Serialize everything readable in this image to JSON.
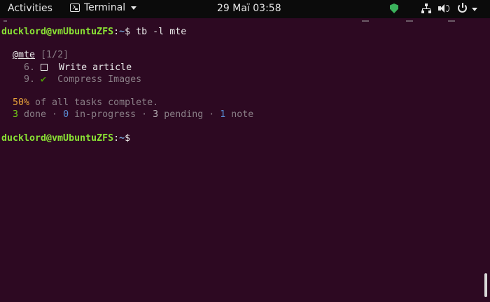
{
  "topbar": {
    "activities": "Activities",
    "app_name": "Terminal",
    "clock": "29 Маї  03:58"
  },
  "icons": {
    "app_icon": "terminal-icon",
    "tray": [
      "shield-icon",
      "network-icon",
      "volume-icon",
      "power-icon",
      "chevron-down-icon"
    ]
  },
  "terminal": {
    "prompt_user": "ducklord@vmUbuntuZFS",
    "prompt_sep": ":",
    "prompt_path": "~",
    "prompt_symbol": "$",
    "command": " tb -l mte",
    "board": {
      "name": "@mte",
      "count": "[1/2]"
    },
    "tasks": [
      {
        "id": "6.",
        "text": "Write article",
        "status": "pending"
      },
      {
        "id": "9.",
        "text": "Compress Images",
        "status": "done",
        "mark": "✔"
      }
    ],
    "summary": {
      "percent": "50%",
      "percent_text": " of all tasks complete.",
      "done_count": "3",
      "done_label": " done · ",
      "in_progress_count": "0",
      "in_progress_label": " in-progress · ",
      "pending_count": "3",
      "pending_label": " pending · ",
      "note_count": "1",
      "note_label": " note"
    }
  },
  "colors": {
    "background": "#2d0922",
    "prompt_user": "#8ae234",
    "prompt_path": "#729fcf",
    "percent": "#e8a23a",
    "done": "#73d216",
    "in_progress": "#5a8fd8"
  }
}
